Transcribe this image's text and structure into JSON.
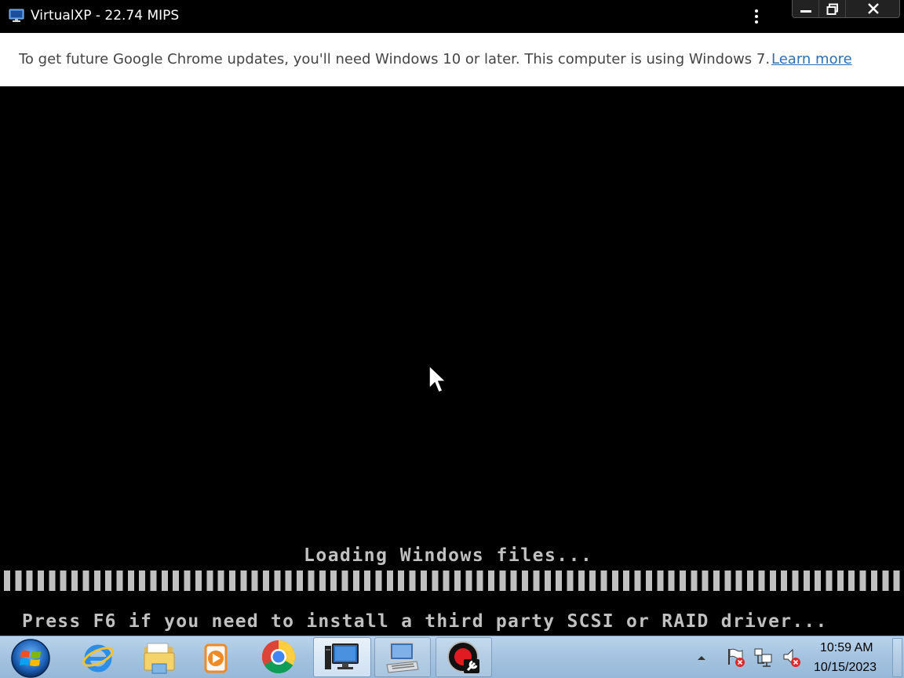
{
  "window": {
    "title": "VirtualXP - 22.74 MIPS",
    "icon": "monitor-icon",
    "controls": [
      "minimize-icon",
      "restore-icon",
      "close-icon"
    ]
  },
  "infobar": {
    "message": "To get future Google Chrome updates, you'll need Windows 10 or later. This computer is using Windows 7.",
    "link_label": "Learn more"
  },
  "vm": {
    "loading_text": "Loading Windows files...",
    "progress": 1.0,
    "f6_prompt": "Press F6 if you need to install a third party SCSI or RAID driver..."
  },
  "taskbar": {
    "start_icon": "windows-start-orb-icon",
    "items": [
      {
        "name": "internet-explorer-icon",
        "state": "pinned"
      },
      {
        "name": "file-explorer-icon",
        "state": "pinned"
      },
      {
        "name": "media-player-icon",
        "state": "pinned"
      },
      {
        "name": "chrome-icon",
        "state": "pinned"
      },
      {
        "name": "virtualxp-icon",
        "state": "active"
      },
      {
        "name": "on-screen-keyboard-icon",
        "state": "open"
      },
      {
        "name": "record-tool-icon",
        "state": "open"
      }
    ],
    "tray": {
      "icons": [
        "show-hidden-icons-arrow",
        "action-center-flag-icon",
        "network-icon",
        "volume-muted-icon"
      ],
      "time": "10:59 AM",
      "date": "10/15/2023"
    }
  },
  "colors": {
    "link": "#2d6fb5",
    "console_text": "#c0c0c0",
    "taskbar": "#a4c3e0"
  }
}
